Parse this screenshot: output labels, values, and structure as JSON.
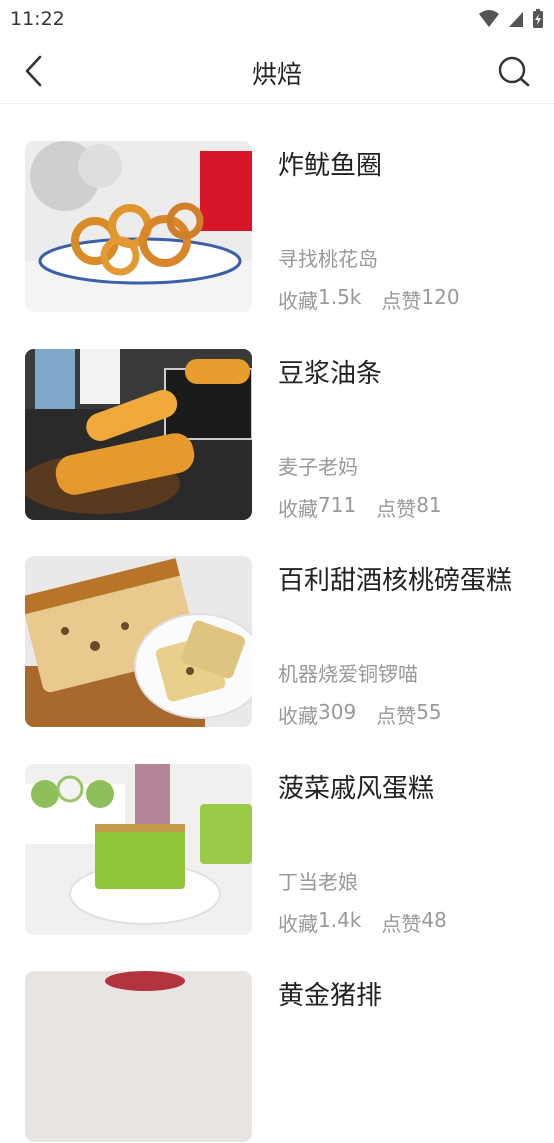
{
  "status": {
    "time": "11:22"
  },
  "nav": {
    "title": "烘焙"
  },
  "recipes": [
    {
      "title": "炸鱿鱼圈",
      "author": "寻找桃花岛",
      "fav_label": "收藏",
      "fav": "1.5k",
      "like_label": "点赞",
      "like": "120",
      "image": "fried-squid-rings"
    },
    {
      "title": "豆浆油条",
      "author": "麦子老妈",
      "fav_label": "收藏",
      "fav": "711",
      "like_label": "点赞",
      "like": "81",
      "image": "youtiao"
    },
    {
      "title": "百利甜酒核桃磅蛋糕",
      "author": "机器烧爱铜锣喵",
      "fav_label": "收藏",
      "fav": "309",
      "like_label": "点赞",
      "like": "55",
      "image": "walnut-pound-cake"
    },
    {
      "title": "菠菜戚风蛋糕",
      "author": "丁当老娘",
      "fav_label": "收藏",
      "fav": "1.4k",
      "like_label": "点赞",
      "like": "48",
      "image": "spinach-chiffon-cake"
    },
    {
      "title": "黄金猪排",
      "author": "",
      "fav_label": "",
      "fav": "",
      "like_label": "",
      "like": "",
      "image": "partial"
    }
  ]
}
